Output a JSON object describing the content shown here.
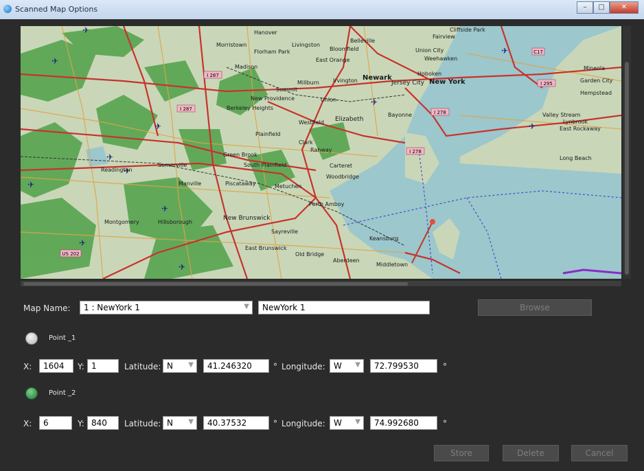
{
  "window": {
    "title": "Scanned Map Options"
  },
  "map_labels": {
    "hanover": "Hanover",
    "livingston": "Livingston",
    "florham_park": "Florham Park",
    "morristown": "Morristown",
    "madison": "Madison",
    "summit": "Summit",
    "new_providence": "New Providence",
    "berkeley_heights": "Berkeley Heights",
    "millburn": "Millburn",
    "irvington": "Irvington",
    "newark": "Newark",
    "jersey_city": "Jersey City",
    "hoboken": "Hoboken",
    "new_york": "New York",
    "union": "Union",
    "elizabeth": "Elizabeth",
    "bayonne": "Bayonne",
    "westfield": "Westfield",
    "plainfield": "Plainfield",
    "clark": "Clark",
    "rahway": "Rahway",
    "green_brook": "Green Brook",
    "south_plainfield": "South Plainfield",
    "somerville": "Somerville",
    "carteret": "Carteret",
    "woodbridge": "Woodbridge",
    "piscataway": "Piscataway",
    "metuchen": "Metuchen",
    "perth_amboy": "Perth Amboy",
    "new_brunswick": "New Brunswick",
    "hillsborough": "Hillsborough",
    "montgomery": "Montgomery",
    "manville": "Manville",
    "east_brunswick": "East Brunswick",
    "sayreville": "Sayreville",
    "old_bridge": "Old Bridge",
    "keansburg": "Keansburg",
    "middletown": "Middletown",
    "long_beach": "Long Beach",
    "valley_stream": "Valley Stream",
    "lynbrook": "Lynbrook",
    "east_rockaway": "East Rockaway",
    "garden_city": "Garden City",
    "hempstead": "Hempstead",
    "mineola": "Mineola",
    "readington": "Readington",
    "east_orange": "East Orange",
    "bloomfield": "Bloomfield",
    "belleville": "Belleville",
    "weehawken": "Weehawken",
    "union_city": "Union City",
    "fairview": "Fairview",
    "cliffside_park": "Cliffside Park",
    "aberdeen": "Aberdeen",
    "route_287": "I 287",
    "route_278a": "I 278",
    "route_278b": "I 278",
    "route_295": "I 295",
    "route_us202": "US 202",
    "route_c17": "C17"
  },
  "form": {
    "map_name_label": "Map Name:",
    "map_select_value": "1 : NewYork 1",
    "map_name_value": "NewYork 1",
    "browse_label": "Browse",
    "point1": {
      "label": "Point _1",
      "x_label": "X:",
      "x_value": "1604",
      "y_label": "Y:",
      "y_value": "1",
      "lat_label": "Latitude:",
      "lat_dir": "N",
      "lat_value": "41.246320",
      "deg": "°",
      "lon_label": "Longitude:",
      "lon_dir": "W",
      "lon_value": "72.799530"
    },
    "point2": {
      "label": "Point _2",
      "x_label": "X:",
      "x_value": "6",
      "y_label": "Y:",
      "y_value": "840",
      "lat_label": "Latitude:",
      "lat_dir": "N",
      "lat_value": "40.37532",
      "deg": "°",
      "lon_label": "Longitude:",
      "lon_dir": "W",
      "lon_value": "74.992680"
    },
    "store_label": "Store",
    "delete_label": "Delete",
    "cancel_label": "Cancel"
  },
  "colors": {
    "land": "#c9d7b8",
    "forest": "#3f9a3a",
    "water": "#9cc7cc",
    "road_major": "#c8322c",
    "road_minor": "#e0a347",
    "route_marker": "#f3b6c6",
    "dialog_bg": "#2b2b2b",
    "point2_radio": "#1e7a32"
  },
  "icons": {
    "app": "app-globe-icon",
    "dropdown": "chevron-down-icon",
    "minimize": "minimize-icon",
    "maximize": "maximize-icon",
    "close": "close-icon"
  }
}
